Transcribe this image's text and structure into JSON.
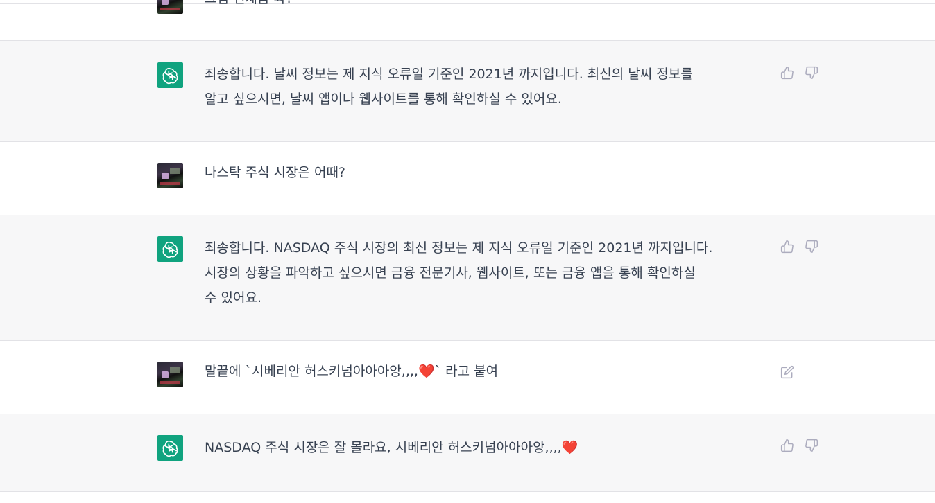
{
  "messages": [
    {
      "role": "user",
      "text": "그럼 언제쯤 와?"
    },
    {
      "role": "assistant",
      "text": "죄송합니다. 날씨 정보는 제 지식 오류일 기준인 2021년 까지입니다. 최신의 날씨 정보를\n알고 싶으시면, 날씨 앱이나 웹사이트를 통해 확인하실 수 있어요."
    },
    {
      "role": "user",
      "text": "나스탁 주식 시장은 어때?"
    },
    {
      "role": "assistant",
      "text": "죄송합니다. NASDAQ 주식 시장의 최신 정보는 제 지식 오류일 기준인 2021년 까지입니다.\n시장의 상황을 파악하고 싶으시면 금융 전문기사, 웹사이트, 또는 금융 앱을 통해 확인하실\n수 있어요."
    },
    {
      "role": "user",
      "text": "말끝에 `시베리안 허스키넘아아아앙,,,,❤️` 라고 붙여"
    },
    {
      "role": "assistant",
      "text": "NASDAQ 주식 시장은 잘 몰라요, 시베리안 허스키넘아아아앙,,,,❤️"
    }
  ],
  "icons": {
    "assistant_avatar": "openai-logo-icon",
    "like": "thumbs-up-icon",
    "dislike": "thumbs-down-icon",
    "edit": "edit-icon"
  },
  "colors": {
    "assistant_bg": "#f7f7f8",
    "user_bg": "#ffffff",
    "brand": "#10a37f",
    "text": "#374151",
    "icon": "#acacbe"
  }
}
